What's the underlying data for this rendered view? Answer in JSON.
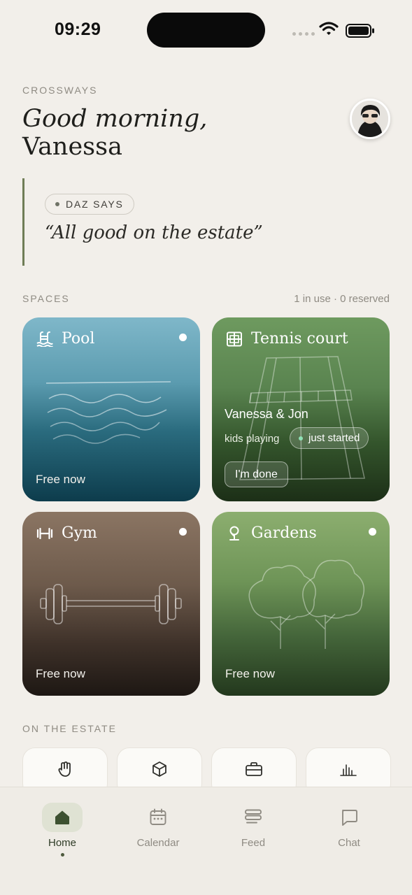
{
  "status_bar": {
    "time": "09:29"
  },
  "header": {
    "app_name": "CROSSWAYS",
    "greeting_line1": "Good morning,",
    "greeting_line2": "Vanessa"
  },
  "quote": {
    "badge": "DAZ SAYS",
    "text": "“All good on the estate”"
  },
  "spaces": {
    "label": "SPACES",
    "meta": "1 in use · 0 reserved",
    "cards": [
      {
        "name": "Pool",
        "icon": "pool-icon",
        "status": "Free now"
      },
      {
        "name": "Tennis court",
        "icon": "tennis-court-icon",
        "players": "Vanessa & Jon",
        "activity": "kids playing",
        "badge": "just started",
        "action": "I'm done"
      },
      {
        "name": "Gym",
        "icon": "dumbbell-icon",
        "status": "Free now"
      },
      {
        "name": "Gardens",
        "icon": "tree-icon",
        "status": "Free now"
      }
    ]
  },
  "estate": {
    "label": "ON THE ESTATE",
    "tiles": [
      "hand-icon",
      "box-icon",
      "briefcase-icon",
      "chart-icon"
    ]
  },
  "tabbar": {
    "tabs": [
      {
        "label": "Home",
        "icon": "home-icon",
        "active": true
      },
      {
        "label": "Calendar",
        "icon": "calendar-icon",
        "active": false
      },
      {
        "label": "Feed",
        "icon": "feed-icon",
        "active": false
      },
      {
        "label": "Chat",
        "icon": "chat-icon",
        "active": false
      }
    ]
  },
  "colors": {
    "background": "#f2efea",
    "accent": "#6f7d56",
    "active_tab_bg": "#dfe2d3",
    "muted_text": "#8f8b83"
  }
}
